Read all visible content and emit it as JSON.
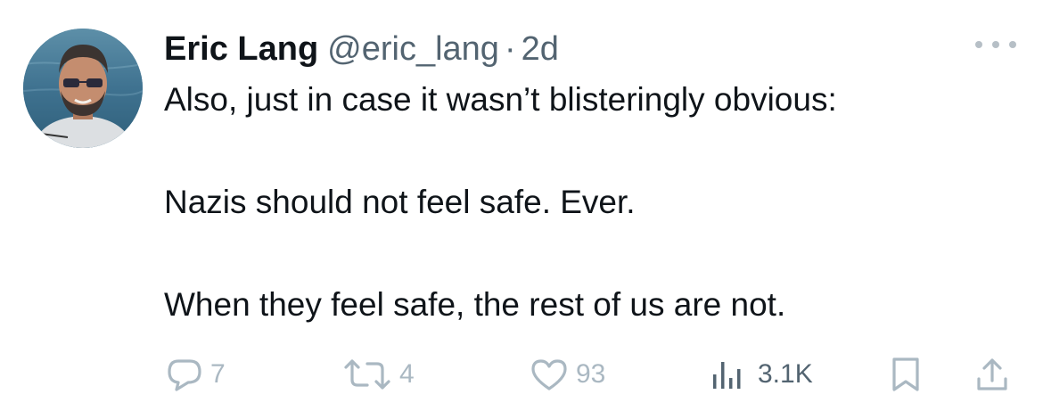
{
  "author": {
    "name": "Eric Lang",
    "handle": "@eric_lang",
    "separator": "·",
    "time": "2d"
  },
  "tweet": {
    "lines": [
      "Also, just in case it wasn’t blisteringly obvious:",
      "Nazis should not feel safe. Ever.",
      "When they feel safe, the rest of us are not."
    ]
  },
  "actions": {
    "replies": "7",
    "retweets": "4",
    "likes": "93",
    "views": "3.1K"
  },
  "icons": {
    "more": "more-horizontal-icon",
    "reply": "reply-bubble-icon",
    "retweet": "retweet-icon",
    "like": "heart-icon",
    "views": "analytics-bars-icon",
    "bookmark": "bookmark-icon",
    "share": "share-upload-icon"
  },
  "colors": {
    "text": "#0f1419",
    "secondary": "#536471",
    "faded_icon": "#aab8c2"
  }
}
